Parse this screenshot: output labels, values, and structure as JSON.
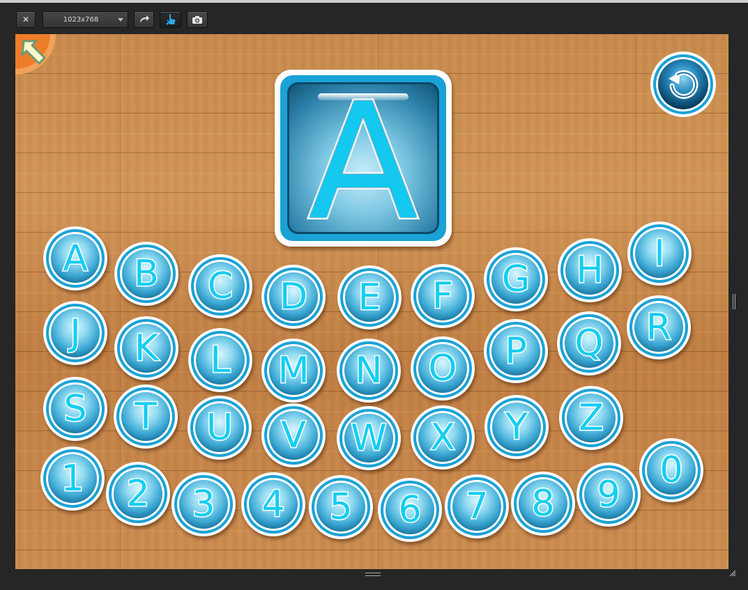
{
  "toolbar": {
    "close_label": "✕",
    "resolution_value": "1023x768",
    "buttons": [
      "close-icon",
      "rotate-icon",
      "touch-icon",
      "camera-icon"
    ]
  },
  "game": {
    "current_letter": "A",
    "colors": {
      "accent": "#1aa2d6",
      "letter": "#14c8ef",
      "wood": "#c88a4c"
    },
    "keys": [
      "A",
      "B",
      "C",
      "D",
      "E",
      "F",
      "G",
      "H",
      "I",
      "J",
      "K",
      "L",
      "M",
      "N",
      "O",
      "P",
      "Q",
      "R",
      "S",
      "T",
      "U",
      "V",
      "W",
      "X",
      "Y",
      "Z",
      "1",
      "2",
      "3",
      "4",
      "5",
      "6",
      "7",
      "8",
      "9",
      "0"
    ]
  }
}
